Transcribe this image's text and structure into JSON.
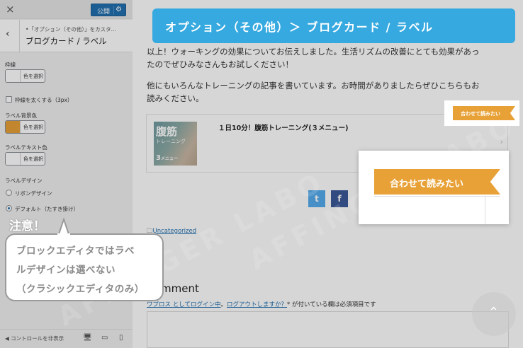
{
  "sidebar": {
    "close_icon": "×",
    "publish_label": "公開",
    "gear_icon": "⚙",
    "back_icon": "‹",
    "breadcrumb": "•「オプション（その他）」をカスタ...",
    "section_title": "ブログカード / ラベル",
    "border_label": "枠線",
    "select_color": "色を選択",
    "thick_border_label": "枠線を太くする（3px）",
    "label_bg_label": "ラベル背景色",
    "label_text_label": "ラベルテキスト色",
    "label_design_label": "ラベルデザイン",
    "ribbon_design": "リボンデザイン",
    "default_design": "デフォルト（たすき掛け）",
    "hide_controls": "コントロールを非表示",
    "desktop_icon": "🖥",
    "tablet_icon": "▭",
    "mobile_icon": "▯",
    "colors": {
      "border_swatch": "#ffffff",
      "label_bg_swatch": "#e8a137",
      "label_text_swatch": "#ffffff"
    }
  },
  "content": {
    "para1_line1": "以上！ウォーキングの効果についてお伝えしました。生活リズムの改善にとても効果があっ",
    "para1_line2": "たのでぜひみなさんもお試しください！",
    "para2_line1": "他にもいろんなトレーニングの記事を書いています。お時間がありましたらぜひこちらもお",
    "para2_line2": "読みください。",
    "card_title": "１日10分！腹筋トレーニング(３メニュー)",
    "thumb_text1": "腹筋",
    "thumb_text2": "トレーニング",
    "thumb_text3": "3",
    "thumb_text3_small": "メニュー",
    "card_chevron": "›",
    "twitter_icon": "t",
    "facebook_icon": "f",
    "category_icon": "🗀",
    "category": "Uncategorized",
    "comment_heading": "mment",
    "logged_link1": "ワプロス としてログイン中",
    "logged_sep": "。",
    "logged_link2": "ログアウトしますか？",
    "logged_rest": "* が付いている欄は必須項目です",
    "scroll_top_icon": "⌃"
  },
  "annotations": {
    "banner": "オプション（その他）＞ ブログカード / ラベル",
    "ribbon_small": "合わせて読みたい",
    "ribbon_big": "合わせて読みたい",
    "note_title": "注意！",
    "bubble_line1": "ブロックエディタではラベ",
    "bubble_line2": "ルデザインは選べない",
    "bubble_line3": "（クラシックエディタのみ）",
    "watermark": "AFFINGER LABO"
  },
  "colors": {
    "accent": "#35a9e0",
    "ribbon": "#e8a137",
    "publish": "#2271b1"
  }
}
